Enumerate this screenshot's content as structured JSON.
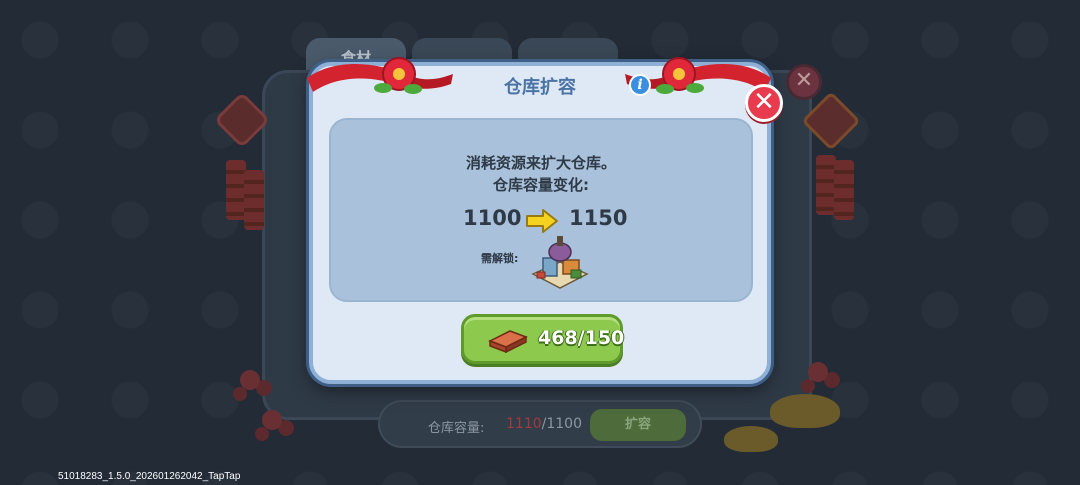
{
  "background": {
    "tabs": [
      "食材",
      "",
      ""
    ],
    "capacity_label": "仓库容量:",
    "capacity_current": "1110",
    "capacity_max": "/1100",
    "expand_button_label": "扩容"
  },
  "modal": {
    "title": "仓库扩容",
    "info_icon": "i",
    "close_icon": "✕",
    "description_line1": "消耗资源来扩大仓库。",
    "description_line2": "仓库容量变化:",
    "capacity_from": "1100",
    "capacity_to": "1150",
    "unlock_label": "需解锁:",
    "unlock_icon": "building-icon",
    "cost_text": "468/150",
    "cost_icon": "brick-icon"
  },
  "build_id": "51018283_1.5.0_202601262042_TapTap",
  "colors": {
    "accent_blue": "#4a74a6",
    "close_red": "#e83c4e",
    "button_green": "#8cc94d",
    "arrow_yellow": "#f5d21f"
  }
}
